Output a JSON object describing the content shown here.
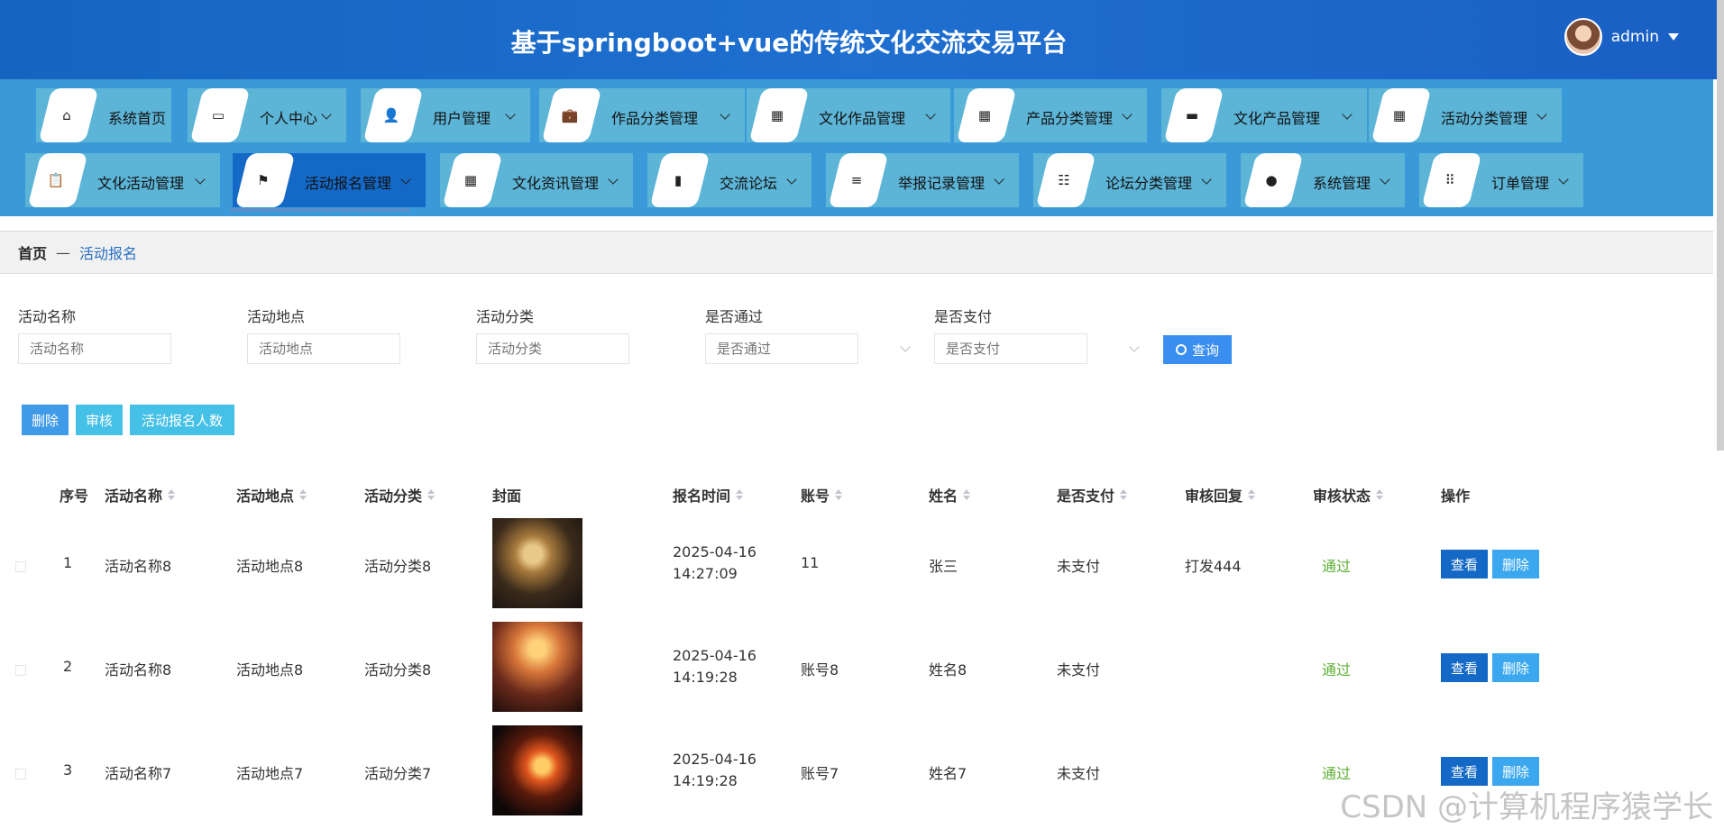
{
  "header": {
    "title": "基于springboot+vue的传统文化交流交易平台",
    "username": "admin"
  },
  "nav": {
    "items": [
      {
        "label": "系统首页",
        "icon": "home-icon",
        "glyph": "⌂",
        "has_chevron": false
      },
      {
        "label": "个人中心",
        "icon": "card-icon",
        "glyph": "▭",
        "has_chevron": true
      },
      {
        "label": "用户管理",
        "icon": "user-icon",
        "glyph": "👤",
        "has_chevron": true
      },
      {
        "label": "作品分类管理",
        "icon": "briefcase-icon",
        "glyph": "💼",
        "has_chevron": true
      },
      {
        "label": "文化作品管理",
        "icon": "grid-icon",
        "glyph": "▦",
        "has_chevron": true
      },
      {
        "label": "产品分类管理",
        "icon": "grid-icon",
        "glyph": "▦",
        "has_chevron": true
      },
      {
        "label": "文化产品管理",
        "icon": "wallet-icon",
        "glyph": "▬",
        "has_chevron": true
      },
      {
        "label": "活动分类管理",
        "icon": "grid-icon",
        "glyph": "▦",
        "has_chevron": true
      },
      {
        "label": "文化活动管理",
        "icon": "clipboard-icon",
        "glyph": "📋",
        "has_chevron": true
      },
      {
        "label": "活动报名管理",
        "icon": "flag-icon",
        "glyph": "⚑",
        "has_chevron": true,
        "active": true
      },
      {
        "label": "文化资讯管理",
        "icon": "grid-icon",
        "glyph": "▦",
        "has_chevron": true
      },
      {
        "label": "交流论坛",
        "icon": "book-icon",
        "glyph": "▮",
        "has_chevron": true
      },
      {
        "label": "举报记录管理",
        "icon": "list-icon",
        "glyph": "≡",
        "has_chevron": true
      },
      {
        "label": "论坛分类管理",
        "icon": "sliders-icon",
        "glyph": "☷",
        "has_chevron": true
      },
      {
        "label": "系统管理",
        "icon": "bulb-icon",
        "glyph": "●",
        "has_chevron": true
      },
      {
        "label": "订单管理",
        "icon": "apps-icon",
        "glyph": "⠿",
        "has_chevron": true
      }
    ]
  },
  "breadcrumb": {
    "home": "首页",
    "separator": "—",
    "current": "活动报名"
  },
  "filters": [
    {
      "label": "活动名称",
      "placeholder": "活动名称",
      "type": "input"
    },
    {
      "label": "活动地点",
      "placeholder": "活动地点",
      "type": "input"
    },
    {
      "label": "活动分类",
      "placeholder": "活动分类",
      "type": "input"
    },
    {
      "label": "是否通过",
      "placeholder": "是否通过",
      "type": "select"
    },
    {
      "label": "是否支付",
      "placeholder": "是否支付",
      "type": "select"
    }
  ],
  "search_label": "查询",
  "actions": {
    "delete": "删除",
    "review": "审核",
    "count": "活动报名人数"
  },
  "table": {
    "columns": [
      "序号",
      "活动名称",
      "活动地点",
      "活动分类",
      "封面",
      "报名时间",
      "账号",
      "姓名",
      "是否支付",
      "审核回复",
      "审核状态",
      "操作"
    ],
    "rows": [
      {
        "no": "1",
        "name": "活动名称8",
        "place": "活动地点8",
        "category": "活动分类8",
        "time": "2025-04-16 14:27:09",
        "account": "11",
        "realname": "张三",
        "paid": "未支付",
        "reply": "打发444",
        "status": "通过"
      },
      {
        "no": "2",
        "name": "活动名称8",
        "place": "活动地点8",
        "category": "活动分类8",
        "time": "2025-04-16 14:19:28",
        "account": "账号8",
        "realname": "姓名8",
        "paid": "未支付",
        "reply": "",
        "status": "通过"
      },
      {
        "no": "3",
        "name": "活动名称7",
        "place": "活动地点7",
        "category": "活动分类7",
        "time": "2025-04-16 14:19:28",
        "account": "账号7",
        "realname": "姓名7",
        "paid": "未支付",
        "reply": "",
        "status": "通过"
      }
    ],
    "view_label": "查看",
    "delete_label": "删除"
  },
  "watermark": "CSDN @计算机程序猿学长",
  "colors": {
    "header": "#1565c0",
    "nav_bg": "#3a9ad9",
    "nav_item": "#5cb4d6",
    "nav_active": "#1469c7",
    "status_pass": "#5daf34"
  }
}
